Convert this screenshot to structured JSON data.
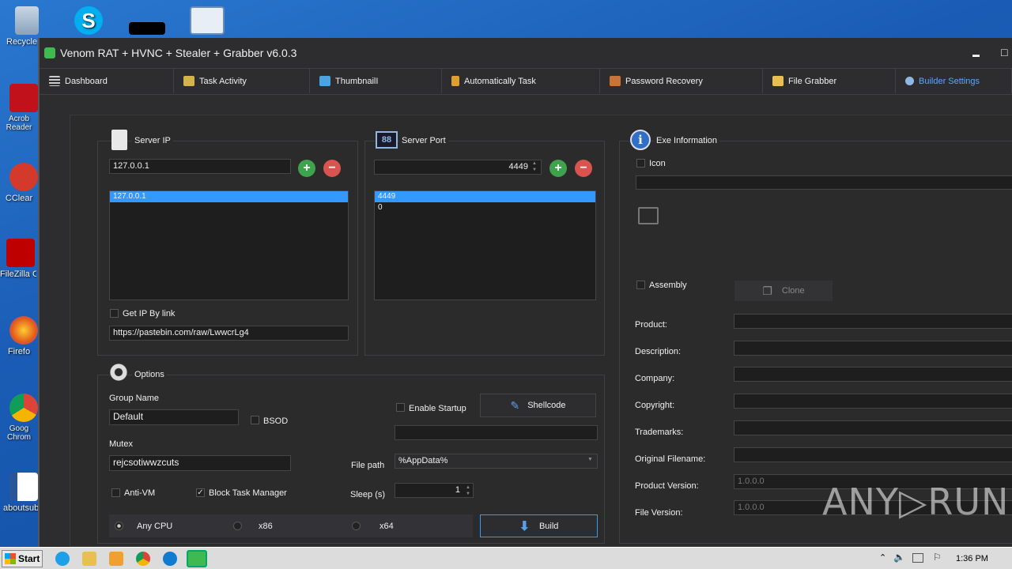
{
  "desktop": {
    "icons": [
      "Recycle",
      "",
      "",
      "",
      "Acrob Reader",
      "CClear",
      "FileZilla C",
      "Firefo",
      "Goog Chrom",
      "aboutsub"
    ]
  },
  "window": {
    "title": "Venom RAT + HVNC + Stealer + Grabber  v6.0.3",
    "min": "▬",
    "max": "□"
  },
  "tabs": [
    {
      "label": "Dashboard"
    },
    {
      "label": "Task Activity"
    },
    {
      "label": "ThumbnailI"
    },
    {
      "label": "Automatically Task"
    },
    {
      "label": "Password Recovery"
    },
    {
      "label": "File Grabber"
    },
    {
      "label": "Builder Settings"
    }
  ],
  "server_ip": {
    "title": "Server IP",
    "input": "127.0.0.1",
    "list": [
      "127.0.0.1"
    ],
    "get_ip_label": "Get IP By link",
    "link": "https://pastebin.com/raw/LwwcrLg4"
  },
  "server_port": {
    "title": "Server Port",
    "input": "4449",
    "list": [
      "4449",
      "0"
    ]
  },
  "options": {
    "title": "Options",
    "group_name_label": "Group Name",
    "group_name": "Default",
    "bsod": "BSOD",
    "mutex_label": "Mutex",
    "mutex": "rejcsotiwwzcuts",
    "anti_vm": "Anti-VM",
    "block_tm": "Block Task Manager",
    "enable_startup": "Enable Startup",
    "shellcode": "Shellcode",
    "file_path_label": "File path",
    "file_path": "%AppData%",
    "sleep_label": "Sleep (s)",
    "sleep": "1",
    "any_cpu": "Any CPU",
    "x86": "x86",
    "x64": "x64",
    "build": "Build"
  },
  "exe": {
    "title": "Exe Information",
    "icon_label": "Icon",
    "assembly_label": "Assembly",
    "clone": "Clone",
    "fields": [
      {
        "label": "Product:",
        "value": ""
      },
      {
        "label": "Description:",
        "value": ""
      },
      {
        "label": "Company:",
        "value": ""
      },
      {
        "label": "Copyright:",
        "value": ""
      },
      {
        "label": "Trademarks:",
        "value": ""
      },
      {
        "label": "Original Filename:",
        "value": ""
      },
      {
        "label": "Product Version:",
        "value": "1.0.0.0"
      },
      {
        "label": "File Version:",
        "value": "1.0.0.0"
      }
    ]
  },
  "taskbar": {
    "start": "Start",
    "time": "1:36 PM"
  },
  "watermark": "ANY▷RUN",
  "colors": {
    "accent": "#3399ff",
    "plus": "#3fa34d",
    "minus": "#d9534f"
  }
}
